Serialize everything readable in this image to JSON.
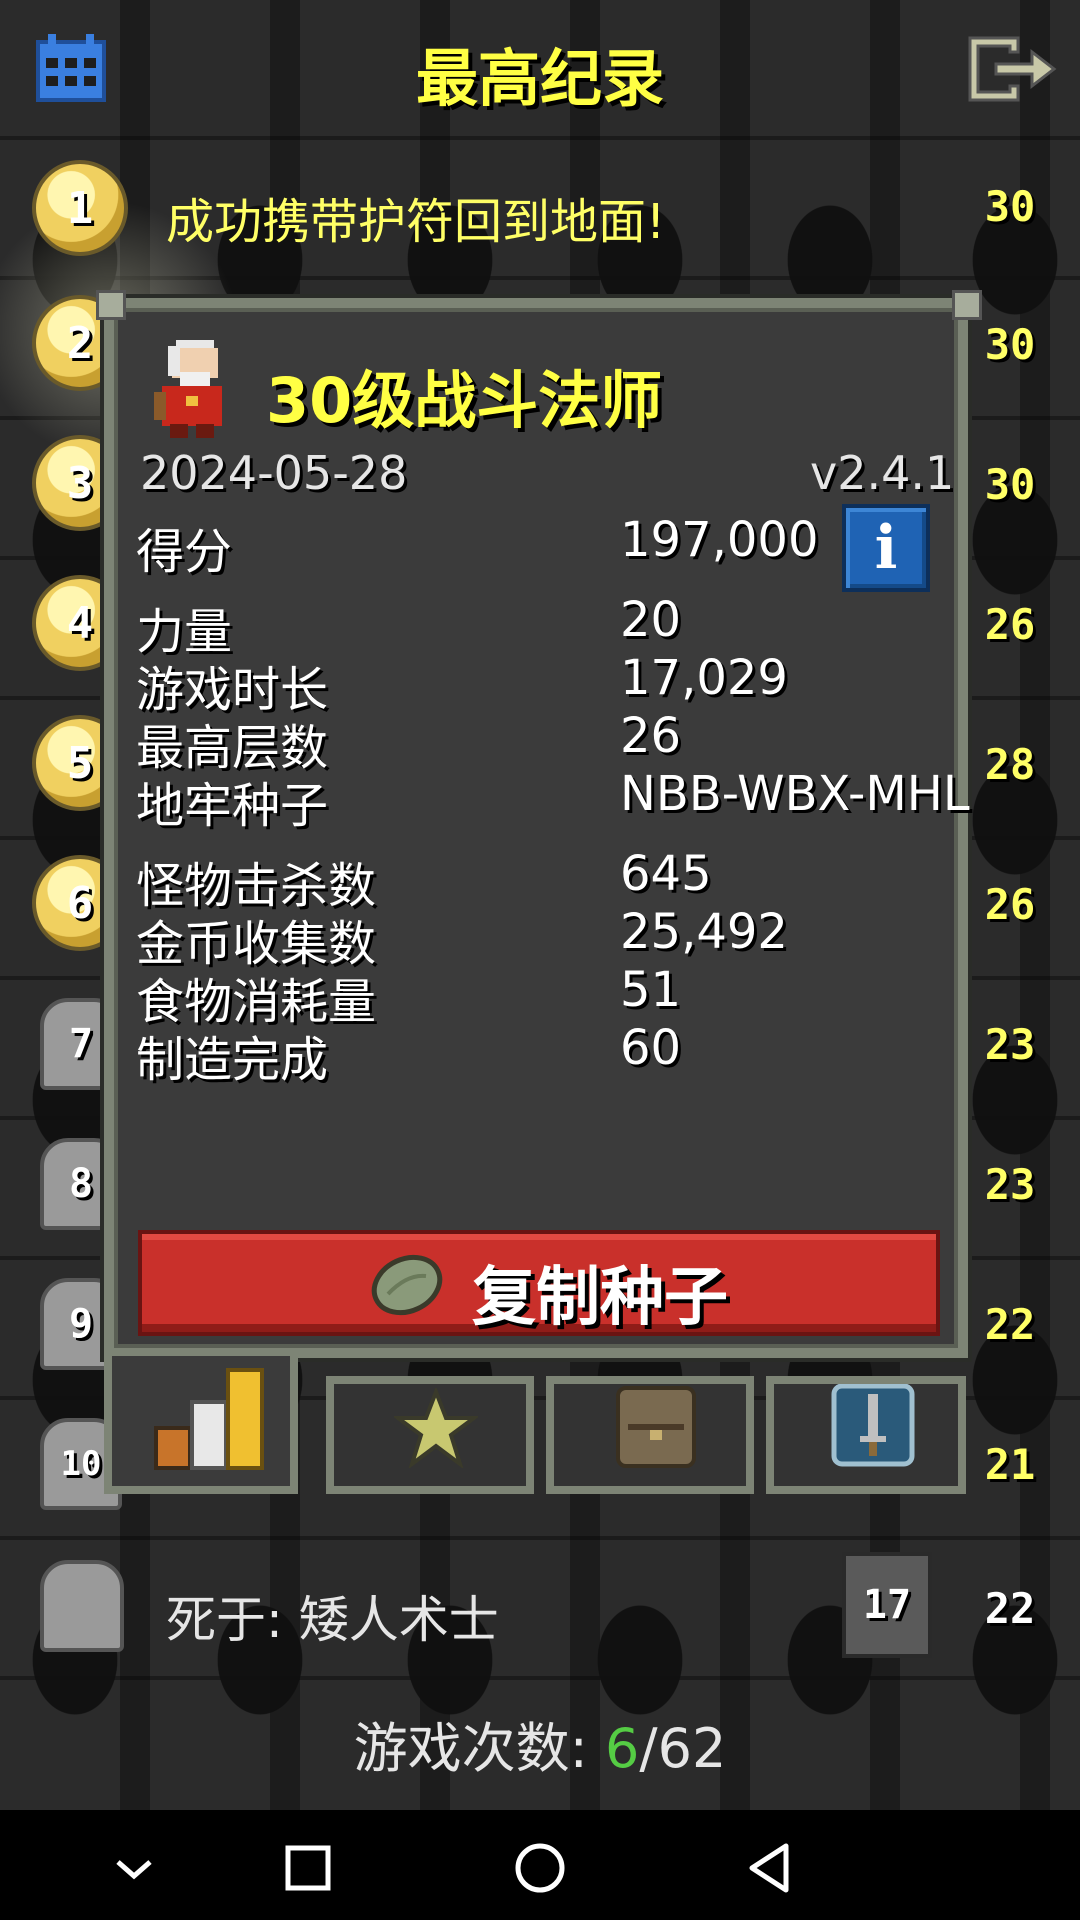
{
  "header": {
    "title": "最高纪录",
    "calendar_icon": "calendar-icon",
    "exit_icon": "exit-icon"
  },
  "records": [
    {
      "rank": "1",
      "text": "成功携带护符回到地面!",
      "level": "30"
    },
    {
      "rank": "2",
      "level": "30"
    },
    {
      "rank": "3",
      "level": "30"
    },
    {
      "rank": "4",
      "level": "26"
    },
    {
      "rank": "5",
      "level": "28"
    },
    {
      "rank": "6",
      "level": "26"
    },
    {
      "rank": "7",
      "level": "23"
    },
    {
      "rank": "8",
      "level": "23"
    },
    {
      "rank": "9",
      "level": "22"
    },
    {
      "rank": "10",
      "level": "21"
    }
  ],
  "last_record": {
    "text": "死于: 矮人术士",
    "depth": "17",
    "level": "22"
  },
  "popup": {
    "hero_title": "30级战斗法师",
    "date": "2024-05-28",
    "version": "v2.4.1",
    "score_label": "得分",
    "score_value": "197,000",
    "stats_group1": [
      {
        "label": "力量",
        "value": "20"
      },
      {
        "label": "游戏时长",
        "value": "17,029"
      },
      {
        "label": "最高层数",
        "value": "26"
      },
      {
        "label": "地牢种子",
        "value": "NBB-WBX-MHL"
      }
    ],
    "stats_group2": [
      {
        "label": "怪物击杀数",
        "value": "645"
      },
      {
        "label": "金币收集数",
        "value": "25,492"
      },
      {
        "label": "食物消耗量",
        "value": "51"
      },
      {
        "label": "制造完成",
        "value": "60"
      }
    ],
    "copy_button_label": "复制种子",
    "tabs": [
      "stats-tab",
      "badges-tab",
      "items-tab",
      "talents-tab"
    ],
    "info_glyph": "i"
  },
  "games_played": {
    "label": "游戏次数: ",
    "current": "6",
    "separator": "/",
    "total": "62"
  },
  "colors": {
    "title_yellow": "#ffff44",
    "copy_button_red": "#c9302b",
    "info_blue": "#1f63b4",
    "current_games_green": "#55cc44"
  }
}
